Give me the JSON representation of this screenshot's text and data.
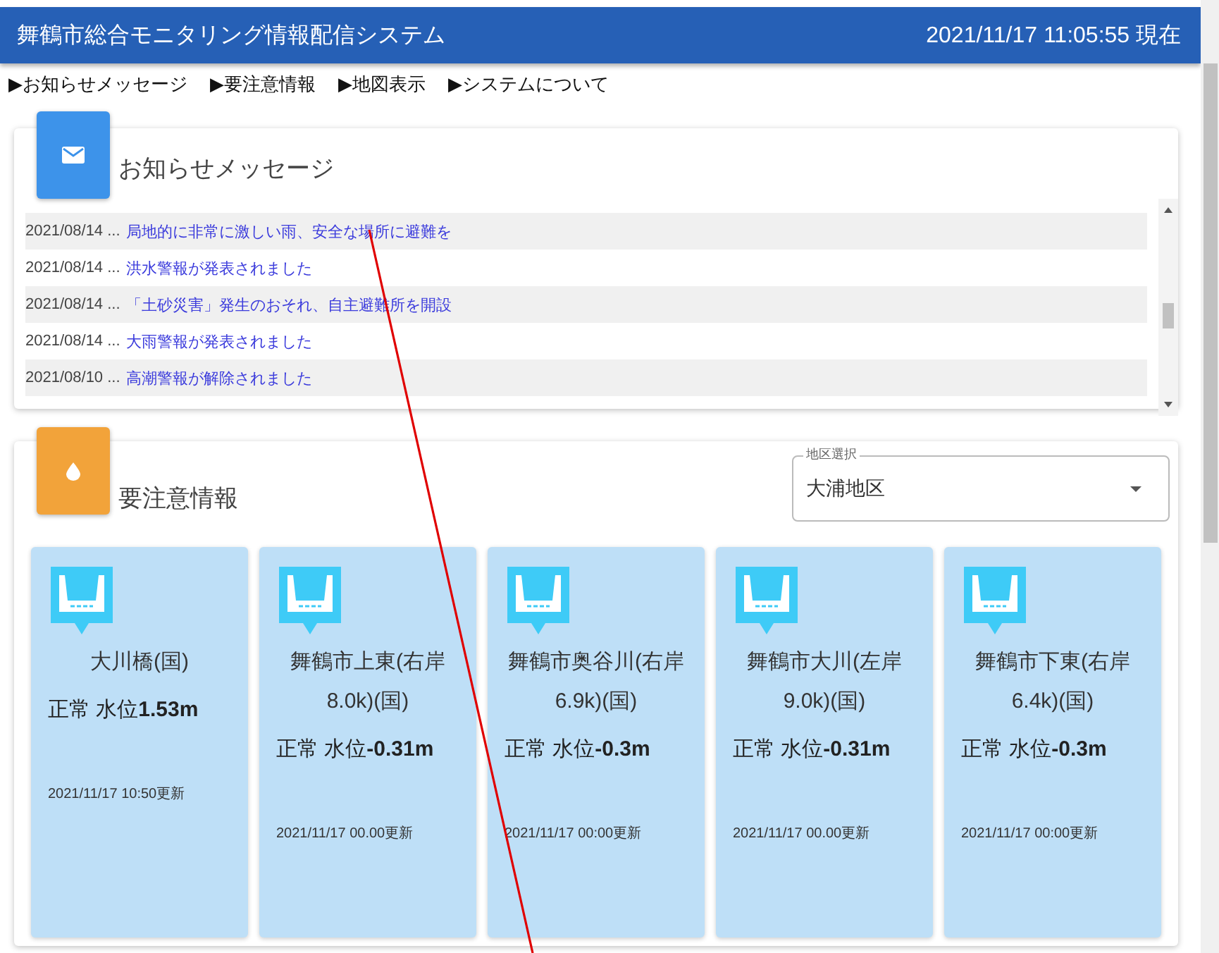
{
  "header": {
    "title": "舞鶴市総合モニタリング情報配信システム",
    "datetime": "2021/11/17 11:05:55 現在"
  },
  "nav": [
    "▶お知らせメッセージ",
    "▶要注意情報",
    "▶地図表示",
    "▶システムについて"
  ],
  "notices": {
    "title": "お知らせメッセージ",
    "items": [
      {
        "date": "2021/08/14 ...",
        "text": "局地的に非常に激しい雨、安全な場所に避難を"
      },
      {
        "date": "2021/08/14 ...",
        "text": "洪水警報が発表されました"
      },
      {
        "date": "2021/08/14 ...",
        "text": "「土砂災害」発生のおそれ、自主避難所を開設"
      },
      {
        "date": "2021/08/14 ...",
        "text": "大雨警報が発表されました"
      },
      {
        "date": "2021/08/10 ...",
        "text": "高潮警報が解除されました"
      }
    ]
  },
  "alerts": {
    "title": "要注意情報",
    "district": {
      "label": "地区選択",
      "value": "大浦地区"
    },
    "stations": [
      {
        "name": "大川橋(国)",
        "status": "正常 水位**1.53m**",
        "updated": "2021/11/17 10:50更新"
      },
      {
        "name": "舞鶴市上東(右岸8.0k)(国)",
        "status": "正常 水位**-0.31m**",
        "updated": "2021/11/17 00.00更新"
      },
      {
        "name": "舞鶴市奥谷川(右岸6.9k)(国)",
        "status": "正常 水位**-0.3m**",
        "updated": "2021/11/17 00:00更新"
      },
      {
        "name": "舞鶴市大川(左岸9.0k)(国)",
        "status": "正常 水位**-0.31m**",
        "updated": "2021/11/17 00.00更新"
      },
      {
        "name": "舞鶴市下東(右岸6.4k)(国)",
        "status": "正常 水位**-0.3m**",
        "updated": "2021/11/17 00:00更新"
      }
    ]
  }
}
